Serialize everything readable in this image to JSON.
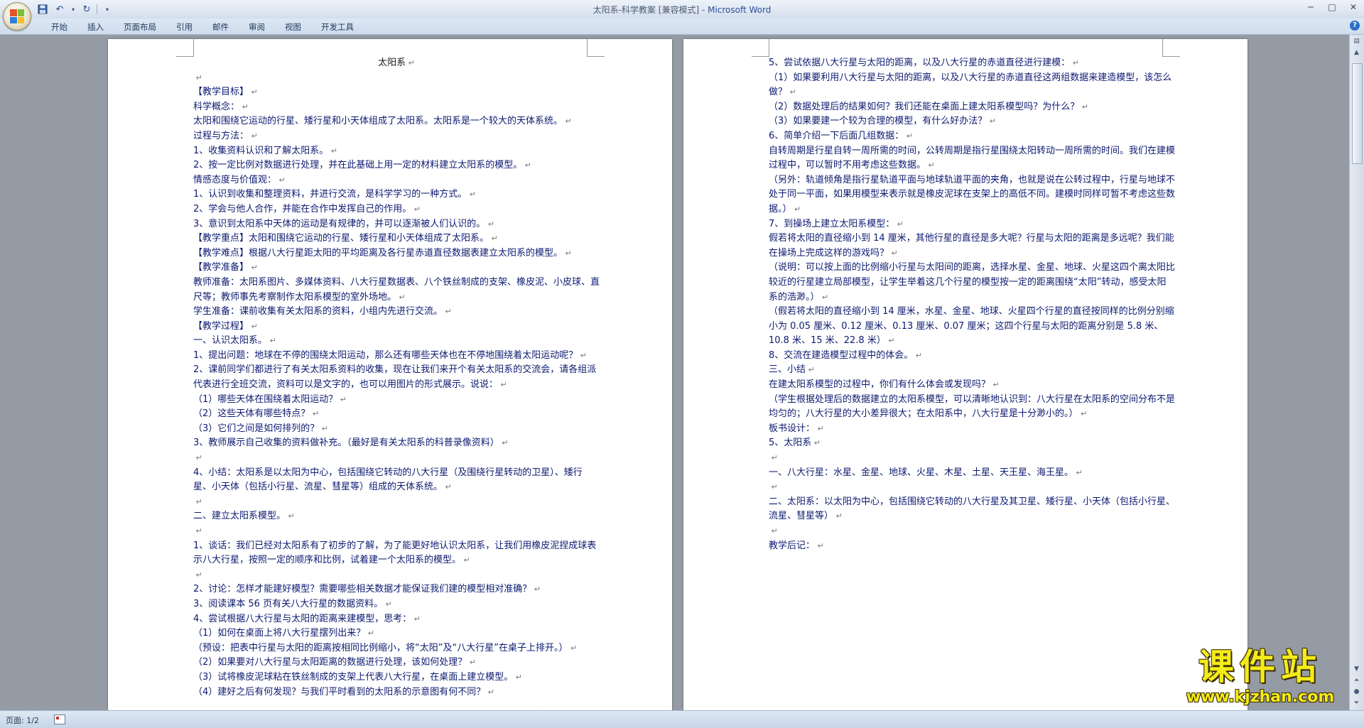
{
  "window": {
    "title": "太阳系-科学教案 [兼容模式] - ",
    "app_name": "Microsoft Word"
  },
  "quick_access": {
    "save_icon": "save-icon",
    "undo_icon": "undo-icon",
    "redo_icon": "redo-icon",
    "customize_icon": "dropdown-icon"
  },
  "ribbon": {
    "tabs": [
      "开始",
      "插入",
      "页面布局",
      "引用",
      "邮件",
      "审阅",
      "视图",
      "开发工具"
    ]
  },
  "page1": {
    "paragraphs": [
      "太阳系",
      "",
      "【教学目标】",
      "科学概念：",
      "太阳和围绕它运动的行星、矮行星和小天体组成了太阳系。太阳系是一个较大的天体系统。",
      "过程与方法：",
      "1、收集资料认识和了解太阳系。",
      "2、按一定比例对数据进行处理，并在此基础上用一定的材料建立太阳系的模型。",
      "情感态度与价值观：",
      "1、认识到收集和整理资料，并进行交流，是科学学习的一种方式。",
      "2、学会与他人合作，并能在合作中发挥自己的作用。",
      "3、意识到太阳系中天体的运动是有规律的，并可以逐渐被人们认识的。",
      "【教学重点】太阳和围绕它运动的行星、矮行星和小天体组成了太阳系。",
      "【教学难点】根据八大行星距太阳的平均距离及各行星赤道直径数据表建立太阳系的模型。",
      "【教学准备】",
      "教师准备：太阳系图片、多媒体资料、八大行星数据表、八个铁丝制成的支架、橡皮泥、小皮球、直尺等；教师事先考察制作太阳系模型的室外场地。",
      "学生准备：课前收集有关太阳系的资料，小组内先进行交流。",
      "【教学过程】",
      "一、认识太阳系。",
      "1、提出问题：地球在不停的围绕太阳运动，那么还有哪些天体也在不停地围绕着太阳运动呢？",
      "2、课前同学们都进行了有关太阳系资料的收集，现在让我们来开个有关太阳系的交流会，请各组派代表进行全班交流，资料可以是文字的，也可以用图片的形式展示。说说：",
      "（1）哪些天体在围绕着太阳运动？",
      "（2）这些天体有哪些特点？",
      "（3）它们之间是如何排列的？",
      "3、教师展示自己收集的资料做补充。（最好是有关太阳系的科普录像资料）",
      "",
      "4、小结：太阳系是以太阳为中心，包括围绕它转动的八大行星（及围绕行星转动的卫星）、矮行星、小天体（包括小行星、流星、彗星等）组成的天体系统。",
      "",
      "二、建立太阳系模型。",
      "",
      "1、谈话：我们已经对太阳系有了初步的了解，为了能更好地认识太阳系，让我们用橡皮泥捏成球表示八大行星，按照一定的顺序和比例，试着建一个太阳系的模型。",
      "",
      "2、讨论：怎样才能建好模型？需要哪些相关数据才能保证我们建的模型相对准确？",
      "3、阅读课本 56 页有关八大行星的数据资料。",
      "4、尝试根据八大行星与太阳的距离来建模型，思考：",
      "（1）如何在桌面上将八大行星摆列出来？",
      "（预设：把表中行星与太阳的距离按相同比例缩小，将“太阳”及“八大行星”在桌子上排开。）",
      "（2）如果要对八大行星与太阳距离的数据进行处理，该如何处理？",
      "（3）试将橡皮泥球粘在铁丝制成的支架上代表八大行星，在桌面上建立模型。",
      "（4）建好之后有何发现？与我们平时看到的太阳系的示意图有何不同？"
    ]
  },
  "page2": {
    "paragraphs": [
      "5、尝试依据八大行星与太阳的距离，以及八大行星的赤道直径进行建模：",
      "（1）如果要利用八大行星与太阳的距离，以及八大行星的赤道直径这两组数据来建造模型，该怎么做？",
      "（2）数据处理后的结果如何？我们还能在桌面上建太阳系模型吗？为什么？",
      "（3）如果要建一个较为合理的模型，有什么好办法？",
      "6、简单介绍一下后面几组数据：",
      "自转周期是行星自转一周所需的时间，公转周期是指行星围绕太阳转动一周所需的时间。我们在建模过程中，可以暂时不用考虑这些数据。",
      "（另外：轨道倾角是指行星轨道平面与地球轨道平面的夹角，也就是说在公转过程中，行星与地球不处于同一平面，如果用模型来表示就是橡皮泥球在支架上的高低不同。建模时同样可暂不考虑这些数据。）",
      "7、到操场上建立太阳系模型：",
      "假若将太阳的直径缩小到 14 厘米，其他行星的直径是多大呢？行星与太阳的距离是多远呢？我们能在操场上完成这样的游戏吗？",
      "（说明：可以按上面的比例缩小行星与太阳间的距离，选择水星、金星、地球、火星这四个离太阳比较近的行星建立局部模型，让学生举着这几个行星的模型按一定的距离围绕“太阳”转动，感受太阳系的浩渺。）",
      "（假若将太阳的直径缩小到 14 厘米，水星、金星、地球、火星四个行星的直径按同样的比例分别缩小为 0.05 厘米、0.12 厘米、0.13 厘米、0.07 厘米；这四个行星与太阳的距离分别是 5.8 米、10.8 米、15 米、22.8 米）",
      "8、交流在建造模型过程中的体会。",
      "三、小结",
      "在建太阳系模型的过程中，你们有什么体会或发现吗？",
      "（学生根据处理后的数据建立的太阳系模型，可以清晰地认识到：八大行星在太阳系的空间分布不是均匀的；八大行星的大小差异很大；在太阳系中，八大行星是十分渺小的。）",
      "板书设计：",
      "5、太阳系",
      "",
      "一、八大行星：水星、金星、地球、火星、木星、土星、天王星、海王星。",
      "",
      "二、太阳系：以太阳为中心，包括围绕它转动的八大行星及其卫星、矮行星、小天体（包括小行星、流星、彗星等）",
      "",
      "教学后记："
    ]
  },
  "statusbar": {
    "page_info": "页面: 1/2"
  },
  "watermark": {
    "cn": "课件站",
    "url": "www.kjzhan.com"
  }
}
